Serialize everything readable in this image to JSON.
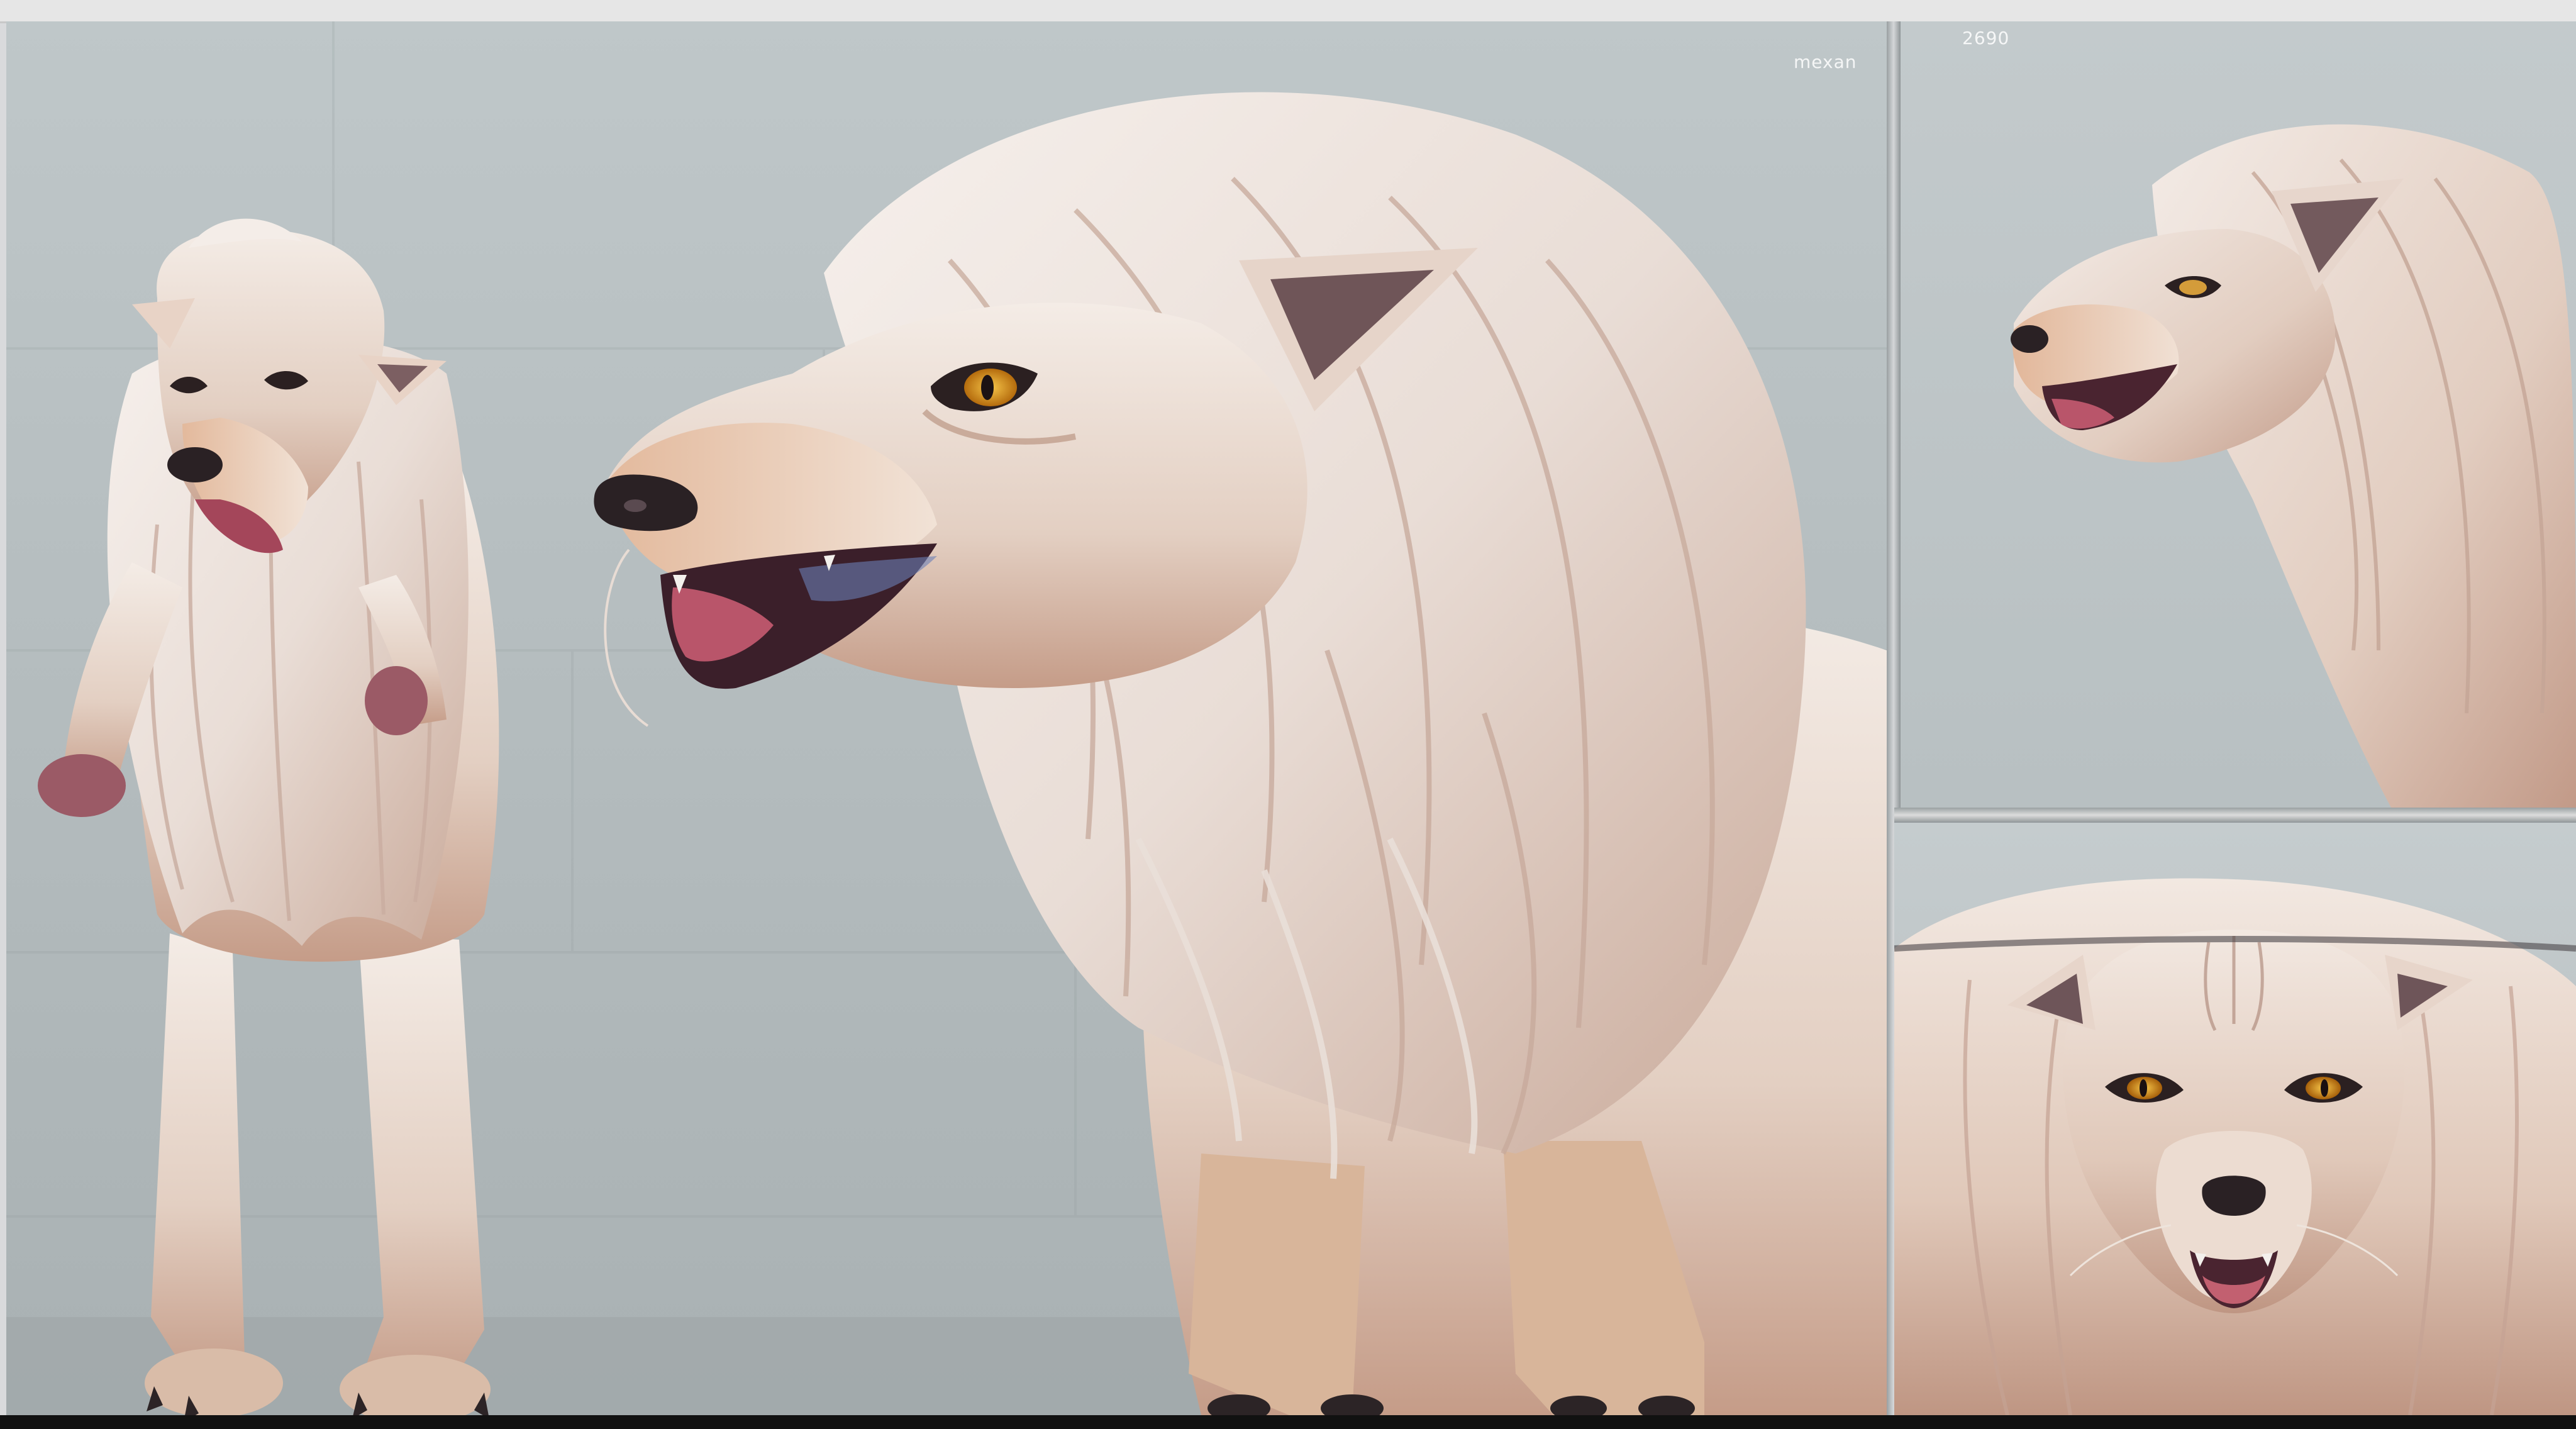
{
  "image": {
    "description_panels": [
      "full-body-front",
      "head-profile-large",
      "head-profile-small",
      "face-front-closeup"
    ]
  },
  "captions": {
    "top_label_1": "mexan",
    "top_label_2": "2690"
  },
  "colors": {
    "background_wall": "#b7bfc1",
    "fur_light": "#efe6e0",
    "fur_warm": "#d8b59a",
    "fur_shadow": "#a87e70",
    "eye": "#e6a21a",
    "nose": "#2a2124",
    "tongue": "#b9556a"
  }
}
